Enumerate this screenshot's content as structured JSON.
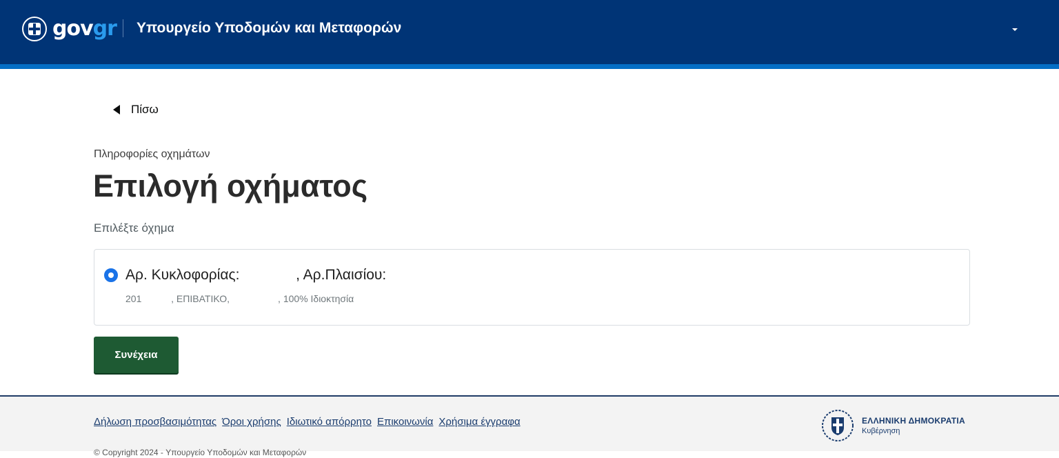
{
  "header": {
    "logo": {
      "gov": "gov",
      "gr": "gr"
    },
    "ministry": "Υπουργείο Υποδομών και Μεταφορών",
    "user_menu": {
      "name": ""
    }
  },
  "main": {
    "back_label": "Πίσω",
    "caption": "Πληροφορίες οχημάτων",
    "title": "Επιλογή οχήματος",
    "legend": "Επιλέξτε όχημα",
    "vehicle_option": {
      "title": "Αρ. Κυκλοφορίας:              , Αρ.Πλαισίου:",
      "details": "201           , ΕΠΙΒΑΤΙΚΟ,                  , 100% Ιδιοκτησία",
      "selected": true
    },
    "continue_label": "Συνέχεια"
  },
  "footer": {
    "links": [
      "Δήλωση προσβασιμότητας",
      "Όροι χρήσης",
      "Ιδιωτικό απόρρητο",
      "Επικοινωνία",
      "Χρήσιμα έγγραφα"
    ],
    "copyright": "© Copyright 2024 - Υπουργείο Υποδομών και Μεταφορών",
    "gov_name": "ΕΛΛΗΝΙΚΗ ΔΗΜΟΚΡΑΤΙΑ",
    "gov_sub": "Κυβέρνηση"
  },
  "colors": {
    "header_bg": "#003476",
    "header_stripe": "#046ec5",
    "button_bg": "#1e5a33",
    "radio_selected": "#1a73e8",
    "link": "#1a3c6e"
  },
  "icons": {
    "header_emblem": "greek-emblem-icon",
    "back": "caret-left-icon",
    "user_menu": "caret-down-icon",
    "footer_emblem": "greek-coat-of-arms-icon"
  }
}
